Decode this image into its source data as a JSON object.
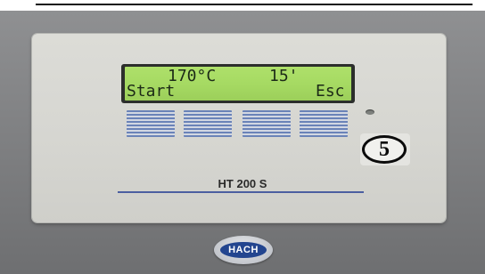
{
  "display": {
    "line1": {
      "temperature": "170°C",
      "time": "15'"
    },
    "line2": {
      "left_softkey": "Start",
      "right_softkey": "Esc"
    }
  },
  "keypad": {
    "keys": [
      {
        "id": "key-1"
      },
      {
        "id": "key-2"
      },
      {
        "id": "key-3"
      },
      {
        "id": "key-4"
      }
    ]
  },
  "indicator": {
    "state": "off"
  },
  "callout": {
    "label": "5"
  },
  "device": {
    "model": "HT 200 S",
    "brand": "HACH"
  },
  "colors": {
    "lcd_background": "#a6da63",
    "lcd_text": "#1c2a17",
    "key_stripe": "#6a83b8",
    "panel": "#d6d6d1",
    "brand_blue": "#23458f"
  },
  "icons": [
    "led-indicator-icon",
    "hach-logo-icon"
  ]
}
